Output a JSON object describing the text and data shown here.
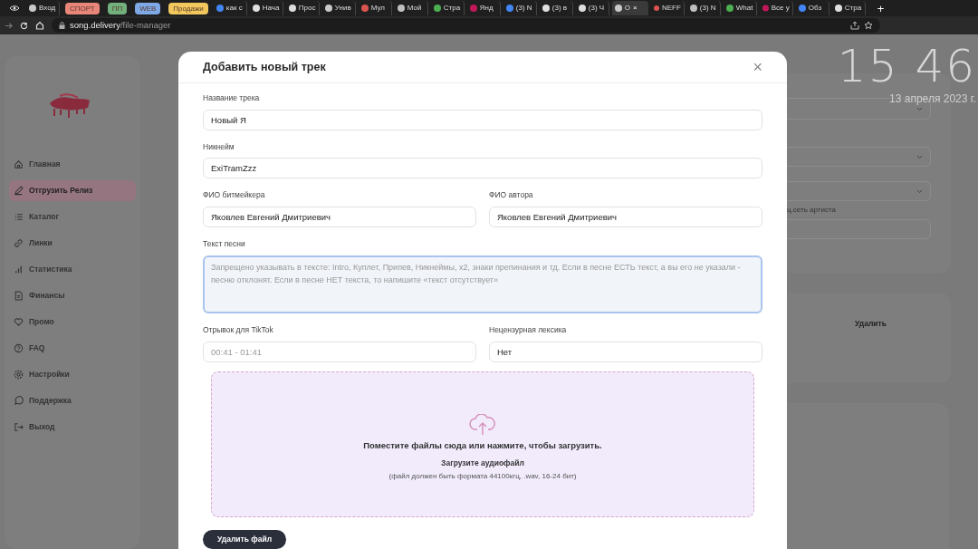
{
  "browser": {
    "tabs": [
      {
        "title": "Вход",
        "kind": "page",
        "selected": false
      },
      {
        "title": "СПОРТ",
        "kind": "group",
        "color": "#e8867a",
        "selected": false
      },
      {
        "title": "ПП",
        "kind": "group",
        "color": "#72b07e",
        "selected": false
      },
      {
        "title": "WEB",
        "kind": "group",
        "color": "#7ea8e6",
        "selected": false
      },
      {
        "title": "Продажи",
        "kind": "group",
        "color": "#f2c85e",
        "selected": false
      },
      {
        "title": "как с",
        "kind": "page",
        "selected": false
      },
      {
        "title": "Нача",
        "kind": "page",
        "selected": false
      },
      {
        "title": "Прос",
        "kind": "page",
        "selected": false
      },
      {
        "title": "Унив",
        "kind": "page",
        "selected": false
      },
      {
        "title": "Мул",
        "kind": "page",
        "selected": false
      },
      {
        "title": "Мой",
        "kind": "page",
        "selected": false
      },
      {
        "title": "Стра",
        "kind": "page",
        "selected": false
      },
      {
        "title": "Янд",
        "kind": "page",
        "selected": false
      },
      {
        "title": "(3) N",
        "kind": "page",
        "selected": false
      },
      {
        "title": "(3) в",
        "kind": "page",
        "selected": false
      },
      {
        "title": "(3) Ч",
        "kind": "page",
        "selected": false
      },
      {
        "title": "О",
        "kind": "page",
        "selected": true,
        "close": "×"
      },
      {
        "title": "NEFF",
        "kind": "page",
        "selected": false
      },
      {
        "title": "(3) N",
        "kind": "page",
        "selected": false
      },
      {
        "title": "What",
        "kind": "page",
        "selected": false
      },
      {
        "title": "Все у",
        "kind": "page",
        "selected": false
      },
      {
        "title": "Обз",
        "kind": "page",
        "selected": false
      },
      {
        "title": "Стра",
        "kind": "page",
        "selected": false
      }
    ],
    "new_tab": "+",
    "url": {
      "domain": "song.delivery",
      "path": "/file-manager"
    }
  },
  "sidebar": {
    "items": [
      {
        "label": "Главная",
        "selected": false
      },
      {
        "label": "Отгрузить Релиз",
        "selected": true
      },
      {
        "label": "Каталог",
        "selected": false
      },
      {
        "label": "Линки",
        "selected": false
      },
      {
        "label": "Статистика",
        "selected": false
      },
      {
        "label": "Финансы",
        "selected": false
      },
      {
        "label": "Промо",
        "selected": false
      },
      {
        "label": "FAQ",
        "selected": false
      },
      {
        "label": "Настройки",
        "selected": false
      },
      {
        "label": "Поддержка",
        "selected": false
      },
      {
        "label": "Выход",
        "selected": false
      }
    ]
  },
  "backdrop": {
    "field_label": "ц.сеть артиста",
    "delete_label": "Удалить"
  },
  "clock": {
    "time": "15 46",
    "date": "13 апреля 2023 г."
  },
  "modal": {
    "title": "Добавить новый трек",
    "close": "×",
    "rows": [
      {
        "fields": [
          {
            "label": "Название трека",
            "kind": "text",
            "value": "Новый Я"
          }
        ]
      },
      {
        "fields": [
          {
            "label": "Никнейм",
            "kind": "text",
            "value": "ExiTramZzz"
          }
        ]
      },
      {
        "fields": [
          {
            "label": "ФИО битмейкера",
            "kind": "text",
            "value": "Яковлев Евгений Дмитриевич"
          },
          {
            "label": "ФИО автора",
            "kind": "text",
            "value": "Яковлев Евгений Дмитриевич"
          }
        ]
      },
      {
        "fields": [
          {
            "label": "Текст песни",
            "kind": "textarea",
            "focused": true,
            "placeholder": "Запрещено указывать в тексте: Intro, Куплет, Припев, Никнеймы, x2, знаки препинания и тд. Если в песне ЕСТЬ текст, а вы его не указали - песню отклонят. Если в песне НЕТ текста, то напишите «текст отсутствует»"
          }
        ]
      },
      {
        "fields": [
          {
            "label": "Отрывок для TikTok",
            "kind": "text",
            "placeholder": "00:41 - 01:41"
          },
          {
            "label": "Нецензурная лексика",
            "kind": "text",
            "value": "Нет"
          }
        ]
      }
    ],
    "dropzone": {
      "title": "Поместите файлы сюда или нажмите, чтобы загрузить.",
      "subtitle": "Загрузите аудиофайл",
      "hint": "(файл должен быть формата 44100кгц, .wav, 16-24 бит)"
    },
    "delete_button": "Удалить файл"
  }
}
